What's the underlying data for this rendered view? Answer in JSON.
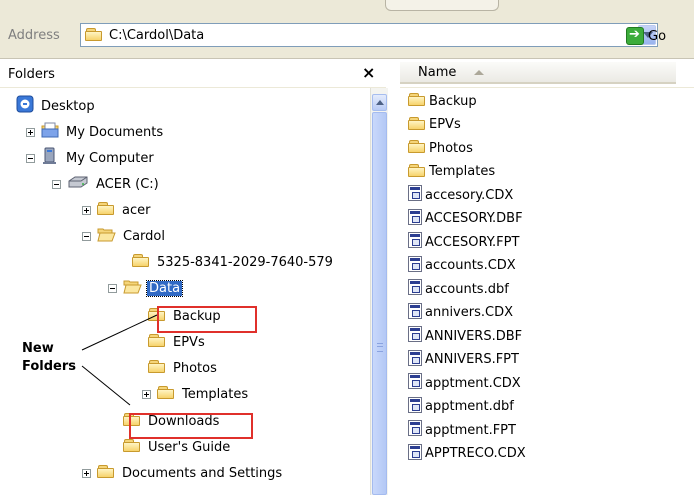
{
  "address": {
    "label": "Address",
    "path": "C:\\Cardol\\Data",
    "go_label": "Go"
  },
  "folders_pane": {
    "title": "Folders",
    "close_glyph": "×",
    "tree": [
      {
        "label": "Desktop",
        "icon": "desktop-icon",
        "expander": "none"
      },
      {
        "label": "My Documents",
        "icon": "my-documents-icon",
        "expander": "plus"
      },
      {
        "label": "My Computer",
        "icon": "my-computer-icon",
        "expander": "minus"
      },
      {
        "label": "ACER (C:)",
        "icon": "drive-icon",
        "expander": "minus"
      },
      {
        "label": "acer",
        "icon": "folder-icon",
        "expander": "plus"
      },
      {
        "label": "Cardol",
        "icon": "open-folder-icon",
        "expander": "minus"
      },
      {
        "label": "5325-8341-2029-7640-579",
        "icon": "folder-icon",
        "expander": "none"
      },
      {
        "label": "Data",
        "icon": "open-folder-icon",
        "expander": "minus",
        "selected": true
      },
      {
        "label": "Backup",
        "icon": "folder-icon",
        "expander": "none",
        "highlighted": true
      },
      {
        "label": "EPVs",
        "icon": "folder-icon",
        "expander": "none"
      },
      {
        "label": "Photos",
        "icon": "folder-icon",
        "expander": "none"
      },
      {
        "label": "Templates",
        "icon": "folder-icon",
        "expander": "plus"
      },
      {
        "label": "Downloads",
        "icon": "folder-icon",
        "expander": "none",
        "highlighted": true
      },
      {
        "label": "User's Guide",
        "icon": "folder-icon",
        "expander": "none"
      },
      {
        "label": "Documents and Settings",
        "icon": "folder-icon",
        "expander": "plus"
      }
    ]
  },
  "annotation": {
    "line1": "New",
    "line2": "Folders",
    "color": "#e0302b"
  },
  "file_list": {
    "column_name": "Name",
    "items": [
      {
        "name": "Backup",
        "type": "folder"
      },
      {
        "name": "EPVs",
        "type": "folder"
      },
      {
        "name": "Photos",
        "type": "folder"
      },
      {
        "name": "Templates",
        "type": "folder"
      },
      {
        "name": "accesory.CDX",
        "type": "file"
      },
      {
        "name": "ACCESORY.DBF",
        "type": "file"
      },
      {
        "name": "ACCESORY.FPT",
        "type": "file"
      },
      {
        "name": "accounts.CDX",
        "type": "file"
      },
      {
        "name": "accounts.dbf",
        "type": "file"
      },
      {
        "name": "annivers.CDX",
        "type": "file"
      },
      {
        "name": "ANNIVERS.DBF",
        "type": "file"
      },
      {
        "name": "ANNIVERS.FPT",
        "type": "file"
      },
      {
        "name": "apptment.CDX",
        "type": "file"
      },
      {
        "name": "apptment.dbf",
        "type": "file"
      },
      {
        "name": "apptment.FPT",
        "type": "file"
      },
      {
        "name": "APPTRECO.CDX",
        "type": "file"
      }
    ]
  },
  "colors": {
    "selection": "#316ac5",
    "highlight_box": "#e0302b",
    "chrome": "#ece9d8"
  }
}
